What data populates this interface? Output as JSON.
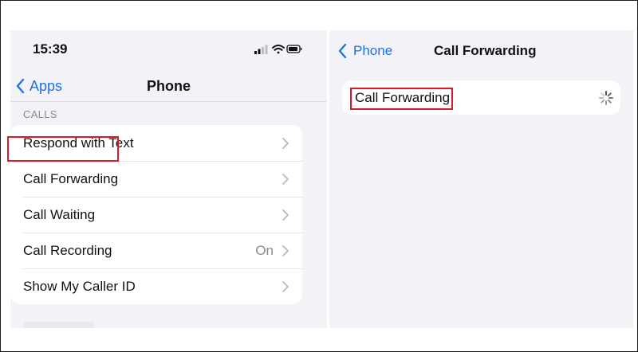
{
  "left_screen": {
    "status_bar": {
      "time": "15:39"
    },
    "nav": {
      "back_label": "Apps",
      "title": "Phone"
    },
    "section_header": "CALLS",
    "rows": [
      {
        "label": "Respond with Text",
        "value": ""
      },
      {
        "label": "Call Forwarding",
        "value": ""
      },
      {
        "label": "Call Waiting",
        "value": ""
      },
      {
        "label": "Call Recording",
        "value": "On"
      },
      {
        "label": "Show My Caller ID",
        "value": ""
      }
    ]
  },
  "right_screen": {
    "nav": {
      "back_label": "Phone",
      "title": "Call Forwarding"
    },
    "row_label": "Call Forwarding",
    "loading": true
  },
  "colors": {
    "accent": "#1a73e8",
    "highlight": "#d81b23",
    "background": "#f2f2f7"
  },
  "icons": [
    "cellular-signal-icon",
    "wifi-icon",
    "battery-icon",
    "chevron-left-icon",
    "chevron-right-icon",
    "loading-spinner-icon"
  ]
}
